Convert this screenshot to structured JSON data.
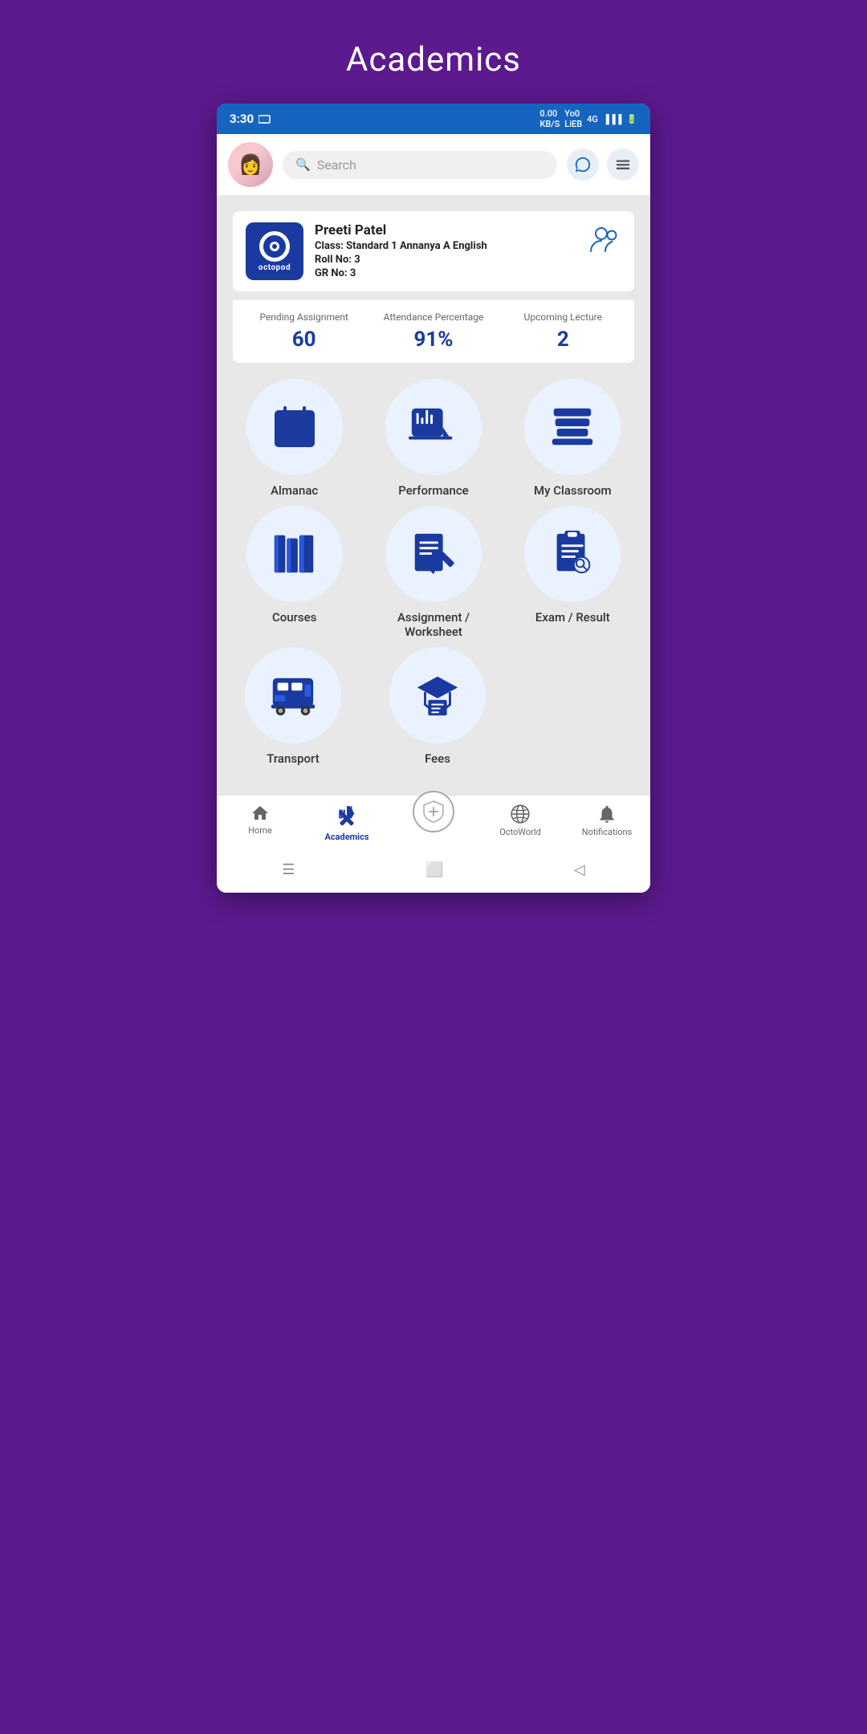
{
  "page": {
    "title": "Academics",
    "bg_color": "#5c1a8e"
  },
  "status_bar": {
    "time": "3:30",
    "network": "0.00 KB/S",
    "carrier": "Yo0",
    "signal": "4G"
  },
  "header": {
    "search_placeholder": "Search",
    "search_icon": "🔍"
  },
  "profile": {
    "name": "Preeti Patel",
    "class_label": "Class:",
    "class_value": "Standard 1 Annanya A English",
    "roll_label": "Roll No:",
    "roll_value": "3",
    "gr_label": "GR No:",
    "gr_value": "3",
    "logo_text": "octopod"
  },
  "stats": [
    {
      "label": "Pending Assignment",
      "value": "60"
    },
    {
      "label": "Attendance Percentage",
      "value": "91%"
    },
    {
      "label": "Upcoming Lecture",
      "value": "2"
    }
  ],
  "grid_items": [
    {
      "id": "almanac",
      "label": "Almanac",
      "icon": "calendar"
    },
    {
      "id": "performance",
      "label": "Performance",
      "icon": "chart"
    },
    {
      "id": "my-classroom",
      "label": "My Classroom",
      "icon": "books-stack"
    },
    {
      "id": "courses",
      "label": "Courses",
      "icon": "books"
    },
    {
      "id": "assignment-worksheet",
      "label": "Assignment /\nWorksheet",
      "icon": "assignment"
    },
    {
      "id": "exam-result",
      "label": "Exam / Result",
      "icon": "clipboard-search"
    },
    {
      "id": "transport",
      "label": "Transport",
      "icon": "bus"
    },
    {
      "id": "fees",
      "label": "Fees",
      "icon": "graduation"
    }
  ],
  "bottom_nav": [
    {
      "id": "home",
      "label": "Home",
      "icon": "🏠",
      "active": false
    },
    {
      "id": "academics",
      "label": "Academics",
      "icon": "✏️",
      "active": true
    },
    {
      "id": "octoworld-center",
      "label": "",
      "icon": "🛡️",
      "active": false
    },
    {
      "id": "octoworld",
      "label": "OctoWorld",
      "icon": "🌐",
      "active": false
    },
    {
      "id": "notifications",
      "label": "Notifications",
      "icon": "🔔",
      "active": false
    }
  ],
  "sys_nav": {
    "menu_icon": "☰",
    "home_icon": "⬜",
    "back_icon": "◁"
  }
}
